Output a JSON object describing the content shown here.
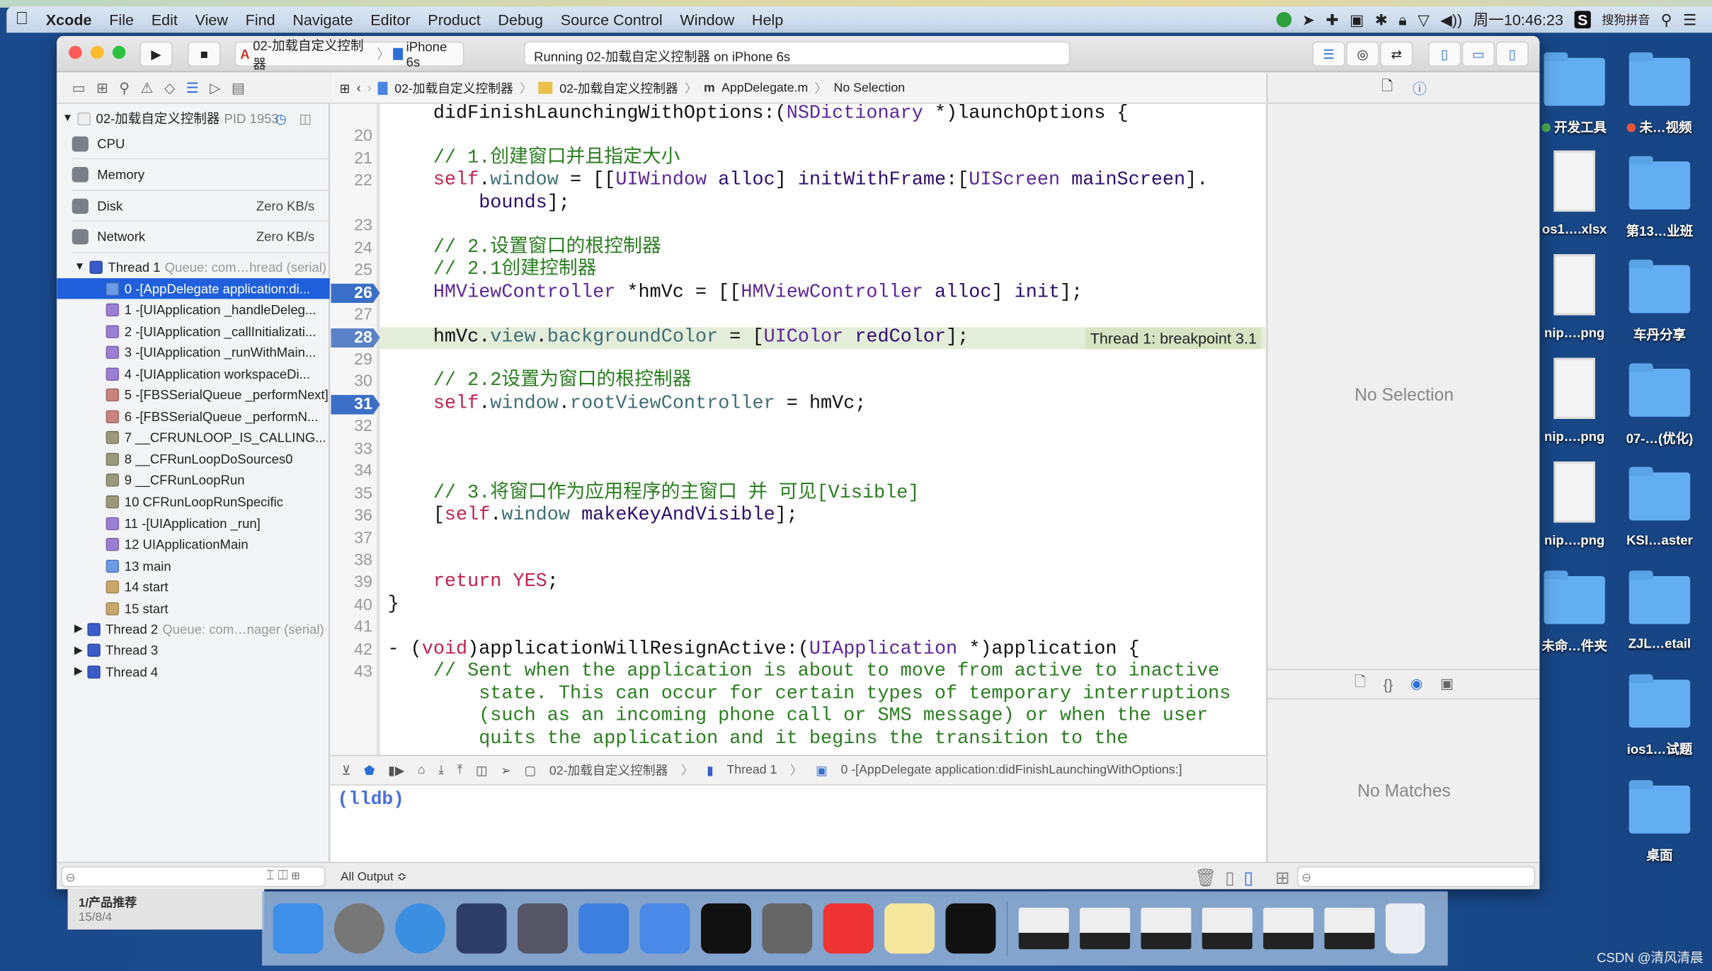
{
  "menubar": {
    "app": "Xcode",
    "items": [
      "File",
      "Edit",
      "View",
      "Find",
      "Navigate",
      "Editor",
      "Product",
      "Debug",
      "Source Control",
      "Window",
      "Help"
    ],
    "clock": "周一10:46:23",
    "ime": "搜狗拼音",
    "status_icons": [
      "green-play-icon",
      "location-icon",
      "plus-icon",
      "camera-icon",
      "bluetooth-icon",
      "lock-icon",
      "wifi-icon",
      "volume-icon"
    ]
  },
  "toolbar": {
    "scheme": "02-加载自定义控制器",
    "device": "iPhone 6s",
    "activity": "Running 02-加载自定义控制器 on iPhone 6s"
  },
  "jumpbar": {
    "items": [
      "02-加载自定义控制器",
      "02-加载自定义控制器",
      "AppDelegate.m",
      "No Selection"
    ]
  },
  "navigator": {
    "process": "02-加载自定义控制器",
    "pid": "PID 1953",
    "gauges": [
      {
        "label": "CPU",
        "value": ""
      },
      {
        "label": "Memory",
        "value": ""
      },
      {
        "label": "Disk",
        "value": "Zero KB/s"
      },
      {
        "label": "Network",
        "value": "Zero KB/s"
      }
    ],
    "thread1": {
      "label": "Thread 1",
      "queue": "Queue: com…hread (serial)"
    },
    "frames": [
      {
        "label": "0 -[AppDelegate application:di...",
        "icon": "user-code-icon",
        "color": "#6b9ae8",
        "selected": true
      },
      {
        "label": "1 -[UIApplication _handleDeleg...",
        "icon": "uikit-icon",
        "color": "#9b7ed6"
      },
      {
        "label": "2 -[UIApplication _callInitializati...",
        "icon": "uikit-icon",
        "color": "#9b7ed6"
      },
      {
        "label": "3 -[UIApplication _runWithMain...",
        "icon": "uikit-icon",
        "color": "#9b7ed6"
      },
      {
        "label": "4 -[UIApplication workspaceDi...",
        "icon": "uikit-icon",
        "color": "#9b7ed6"
      },
      {
        "label": "5 -[FBSSerialQueue _performNext]",
        "icon": "frontboard-icon",
        "color": "#c9847e"
      },
      {
        "label": "6 -[FBSSerialQueue _performN...",
        "icon": "frontboard-icon",
        "color": "#c9847e"
      },
      {
        "label": "7 __CFRUNLOOP_IS_CALLING...",
        "icon": "corefoundation-icon",
        "color": "#9a9a7a"
      },
      {
        "label": "8 __CFRunLoopDoSources0",
        "icon": "corefoundation-icon",
        "color": "#9a9a7a"
      },
      {
        "label": "9 __CFRunLoopRun",
        "icon": "corefoundation-icon",
        "color": "#9a9a7a"
      },
      {
        "label": "10 CFRunLoopRunSpecific",
        "icon": "corefoundation-icon",
        "color": "#9a9a7a"
      },
      {
        "label": "11 -[UIApplication _run]",
        "icon": "uikit-icon",
        "color": "#9b7ed6"
      },
      {
        "label": "12 UIApplicationMain",
        "icon": "uikit-icon",
        "color": "#9b7ed6"
      },
      {
        "label": "13 main",
        "icon": "user-code-icon",
        "color": "#6b9ae8"
      },
      {
        "label": "14 start",
        "icon": "libdyld-icon",
        "color": "#c8a86a"
      },
      {
        "label": "15 start",
        "icon": "libdyld-icon",
        "color": "#c8a86a"
      }
    ],
    "threads": [
      {
        "label": "Thread 2",
        "queue": "Queue: com…nager (serial)"
      },
      {
        "label": "Thread 3",
        "queue": ""
      },
      {
        "label": "Thread 4",
        "queue": ""
      }
    ]
  },
  "code": {
    "lines": [
      {
        "num": "",
        "tokens": [
          [
            "    didFinishLaunchingWithOptions:(",
            "plain"
          ],
          [
            "NSDictionary",
            "cls"
          ],
          [
            " *)launchOptions {",
            "plain"
          ]
        ]
      },
      {
        "num": "20",
        "tokens": []
      },
      {
        "num": "21",
        "tokens": [
          [
            "    // 1.创建窗口并且指定大小",
            "cmt"
          ]
        ]
      },
      {
        "num": "22",
        "tokens": [
          [
            "    ",
            "plain"
          ],
          [
            "self",
            "kw"
          ],
          [
            ".",
            "plain"
          ],
          [
            "window",
            "prop"
          ],
          [
            " = [[",
            "plain"
          ],
          [
            "UIWindow",
            "cls"
          ],
          [
            " ",
            "plain"
          ],
          [
            "alloc",
            "meth"
          ],
          [
            "] ",
            "plain"
          ],
          [
            "initWithFrame",
            "meth"
          ],
          [
            ":[",
            "plain"
          ],
          [
            "UIScreen",
            "cls"
          ],
          [
            " ",
            "plain"
          ],
          [
            "mainScreen",
            "meth"
          ],
          [
            "].",
            "plain"
          ]
        ]
      },
      {
        "num": "",
        "tokens": [
          [
            "        ",
            "plain"
          ],
          [
            "bounds",
            "meth"
          ],
          [
            "];",
            "plain"
          ]
        ]
      },
      {
        "num": "23",
        "tokens": []
      },
      {
        "num": "24",
        "tokens": [
          [
            "    // 2.设置窗口的根控制器",
            "cmt"
          ]
        ]
      },
      {
        "num": "25",
        "tokens": [
          [
            "    // 2.1创建控制器",
            "cmt"
          ]
        ]
      },
      {
        "num": "26",
        "breakpoint": true,
        "tokens": [
          [
            "    ",
            "plain"
          ],
          [
            "HMViewController",
            "cls"
          ],
          [
            " *hmVc = [[",
            "plain"
          ],
          [
            "HMViewController",
            "cls"
          ],
          [
            " ",
            "plain"
          ],
          [
            "alloc",
            "meth"
          ],
          [
            "] ",
            "plain"
          ],
          [
            "init",
            "meth"
          ],
          [
            "];",
            "plain"
          ]
        ]
      },
      {
        "num": "27",
        "tokens": []
      },
      {
        "num": "28",
        "breakpoint": true,
        "current": true,
        "annotation": "Thread 1: breakpoint 3.1",
        "tokens": [
          [
            "    hmVc.",
            "plain"
          ],
          [
            "view",
            "prop"
          ],
          [
            ".",
            "plain"
          ],
          [
            "backgroundColor",
            "prop"
          ],
          [
            " = [",
            "plain"
          ],
          [
            "UIColor",
            "cls"
          ],
          [
            " ",
            "plain"
          ],
          [
            "redColor",
            "meth"
          ],
          [
            "];",
            "plain"
          ]
        ]
      },
      {
        "num": "29",
        "tokens": []
      },
      {
        "num": "30",
        "tokens": [
          [
            "    // 2.2设置为窗口的根控制器",
            "cmt"
          ]
        ]
      },
      {
        "num": "31",
        "breakpoint": true,
        "tokens": [
          [
            "    ",
            "plain"
          ],
          [
            "self",
            "kw"
          ],
          [
            ".",
            "plain"
          ],
          [
            "window",
            "prop"
          ],
          [
            ".",
            "plain"
          ],
          [
            "rootViewController",
            "prop"
          ],
          [
            " = hmVc;",
            "plain"
          ]
        ]
      },
      {
        "num": "32",
        "tokens": []
      },
      {
        "num": "33",
        "tokens": []
      },
      {
        "num": "34",
        "tokens": []
      },
      {
        "num": "35",
        "tokens": [
          [
            "    // 3.将窗口作为应用程序的主窗口 并 可见[Visible]",
            "cmt"
          ]
        ]
      },
      {
        "num": "36",
        "tokens": [
          [
            "    [",
            "plain"
          ],
          [
            "self",
            "kw"
          ],
          [
            ".",
            "plain"
          ],
          [
            "window",
            "prop"
          ],
          [
            " ",
            "plain"
          ],
          [
            "makeKeyAndVisible",
            "meth"
          ],
          [
            "];",
            "plain"
          ]
        ]
      },
      {
        "num": "37",
        "tokens": []
      },
      {
        "num": "38",
        "tokens": []
      },
      {
        "num": "39",
        "tokens": [
          [
            "    ",
            "plain"
          ],
          [
            "return",
            "kw"
          ],
          [
            " ",
            "plain"
          ],
          [
            "YES",
            "kw"
          ],
          [
            ";",
            "plain"
          ]
        ]
      },
      {
        "num": "40",
        "tokens": [
          [
            "}",
            "plain"
          ]
        ]
      },
      {
        "num": "41",
        "tokens": []
      },
      {
        "num": "42",
        "tokens": [
          [
            "- (",
            "plain"
          ],
          [
            "void",
            "kw"
          ],
          [
            ")applicationWillResignActive:(",
            "plain"
          ],
          [
            "UIApplication",
            "cls"
          ],
          [
            " *)application {",
            "plain"
          ]
        ]
      },
      {
        "num": "43",
        "tokens": [
          [
            "    // Sent when the application is about to move from active to inactive",
            "cmt"
          ]
        ]
      },
      {
        "num": "",
        "tokens": [
          [
            "        state. This can occur for certain types of temporary interruptions",
            "cmt"
          ]
        ]
      },
      {
        "num": "",
        "tokens": [
          [
            "        (such as an incoming phone call or SMS message) or when the user",
            "cmt"
          ]
        ]
      },
      {
        "num": "",
        "tokens": [
          [
            "        quits the application and it begins the transition to the",
            "cmt"
          ]
        ]
      }
    ]
  },
  "debugbar": {
    "items": [
      "02-加载自定义控制器",
      "Thread 1",
      "0 -[AppDelegate application:didFinishLaunchingWithOptions:]"
    ]
  },
  "console": {
    "prompt": "(lldb)",
    "filter": "All Output ≎"
  },
  "inspector": {
    "empty": "No Selection",
    "library_empty": "No Matches"
  },
  "notification": {
    "title": "1/产品推荐",
    "date": "15/8/4"
  },
  "dock": {
    "apps": [
      "finder-icon",
      "launchpad-icon",
      "safari-icon",
      "mouse-app-icon",
      "screenflow-icon",
      "xcode-icon",
      "simulator-icon",
      "terminal-icon",
      "system-preferences-icon",
      "xmind-icon",
      "notes-icon",
      "console-icon"
    ],
    "windows": [
      "window-thumb-icon",
      "window-thumb-icon",
      "window-thumb-icon",
      "window-thumb-icon",
      "window-thumb-icon",
      "window-thumb-icon"
    ],
    "trash": "trash-icon"
  },
  "desktop": {
    "icons": [
      {
        "label": "开发工具",
        "kind": "folder",
        "tag": "#4caf50"
      },
      {
        "label": "未…视频",
        "kind": "folder",
        "tag": "#e8543c"
      },
      {
        "label": "os1….xlsx",
        "kind": "doc"
      },
      {
        "label": "第13…业班",
        "kind": "folder"
      },
      {
        "label": "nip….png",
        "kind": "doc"
      },
      {
        "label": "车丹分享",
        "kind": "folder"
      },
      {
        "label": "nip….png",
        "kind": "doc"
      },
      {
        "label": "07-…(优化)",
        "kind": "folder"
      },
      {
        "label": "nip….png",
        "kind": "doc"
      },
      {
        "label": "KSI…aster",
        "kind": "folder"
      },
      {
        "label": "未命…件夹",
        "kind": "folder"
      },
      {
        "label": "ZJL…etail",
        "kind": "folder"
      },
      {
        "label": "ios1…试题",
        "kind": "folder"
      },
      {
        "label": "桌面",
        "kind": "folder"
      }
    ]
  },
  "watermark": "CSDN @清风清晨"
}
